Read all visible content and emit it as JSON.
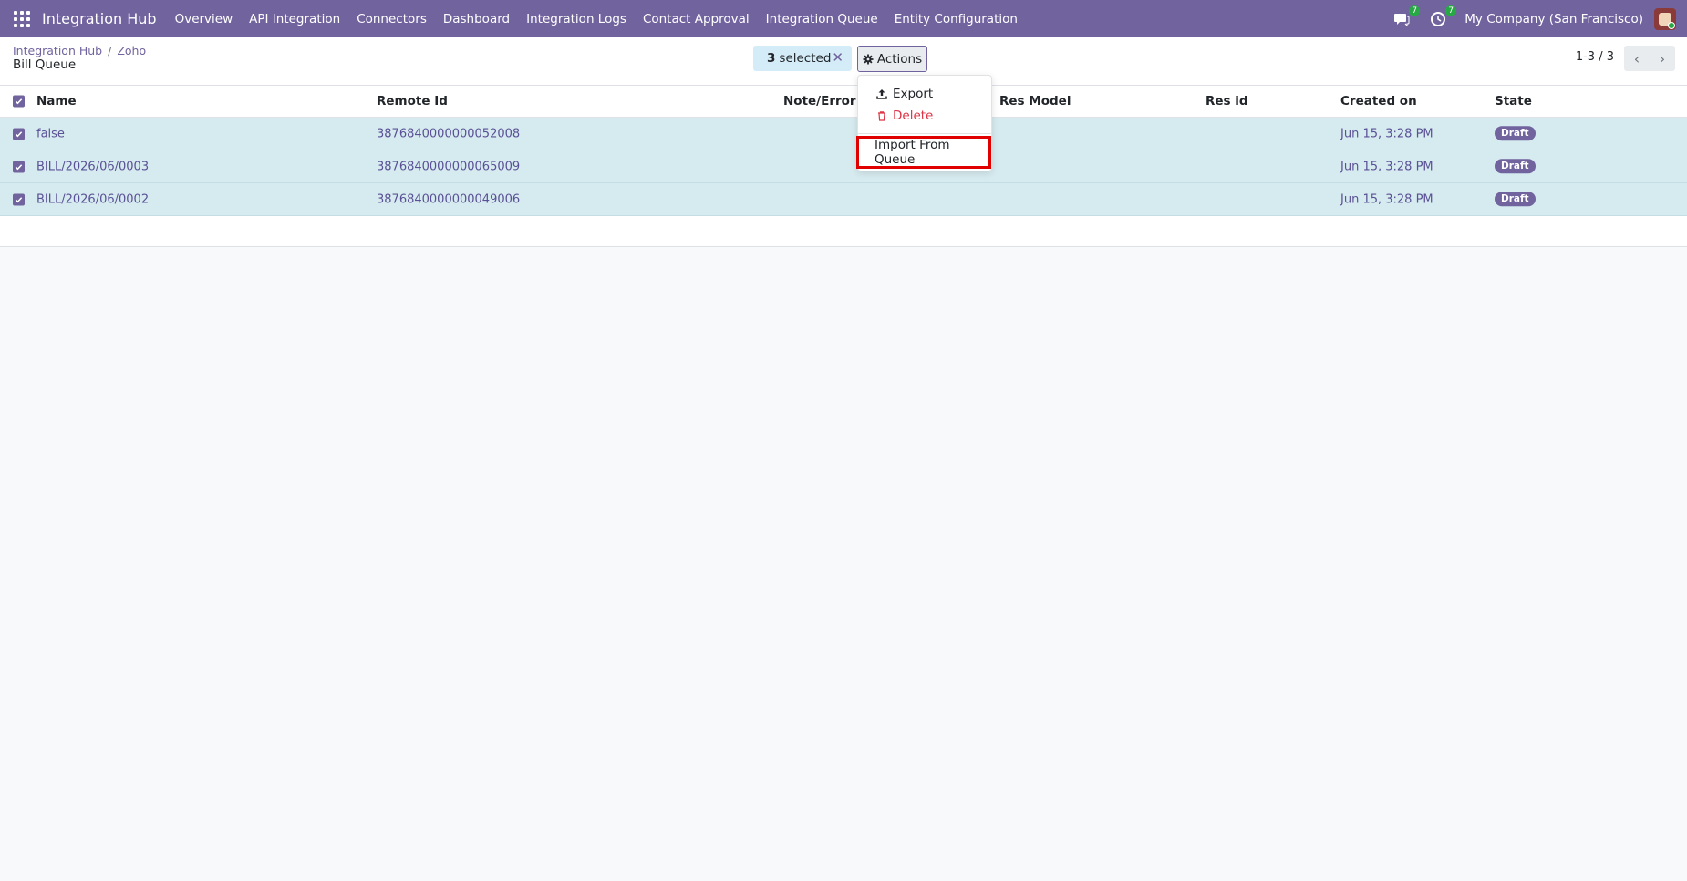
{
  "navbar": {
    "brand": "Integration Hub",
    "menu": [
      "Overview",
      "API Integration",
      "Connectors",
      "Dashboard",
      "Integration Logs",
      "Contact Approval",
      "Integration Queue",
      "Entity Configuration"
    ],
    "messages_count": "7",
    "activities_count": "7",
    "company": "My Company (San Francisco)",
    "icons": {
      "apps": "apps-grid-icon",
      "messages": "chat-icon",
      "activities": "clock-icon"
    }
  },
  "breadcrumb": {
    "root": "Integration Hub",
    "sep": "/",
    "parent": "Zoho"
  },
  "page_title": "Bill Queue",
  "selection": {
    "count": "3",
    "label": "selected",
    "close": "✕"
  },
  "actions": {
    "label": "Actions",
    "icon": "gear-icon"
  },
  "pager": {
    "text": "1-3 / 3",
    "prev": "‹",
    "next": "›"
  },
  "table": {
    "columns": [
      "Name",
      "Remote Id",
      "Note/Error",
      "Res Model",
      "Res id",
      "Created on",
      "State"
    ],
    "rows": [
      {
        "name": "false",
        "remote_id": "3876840000000052008",
        "note": "",
        "res_model": "",
        "res_id": "",
        "created_on": "Jun 15, 3:28 PM",
        "state": "Draft"
      },
      {
        "name": "BILL/2026/06/0003",
        "remote_id": "3876840000000065009",
        "note": "",
        "res_model": "",
        "res_id": "",
        "created_on": "Jun 15, 3:28 PM",
        "state": "Draft"
      },
      {
        "name": "BILL/2026/06/0002",
        "remote_id": "3876840000000049006",
        "note": "",
        "res_model": "",
        "res_id": "",
        "created_on": "Jun 15, 3:28 PM",
        "state": "Draft"
      }
    ]
  },
  "dropdown": {
    "export": "Export",
    "delete": "Delete",
    "import": "Import From Queue"
  },
  "colors": {
    "primary": "#71639e",
    "row_selected": "#d6ebf0",
    "danger": "#dc3545",
    "highlight": "#e00000",
    "badge_green": "#28a745"
  }
}
